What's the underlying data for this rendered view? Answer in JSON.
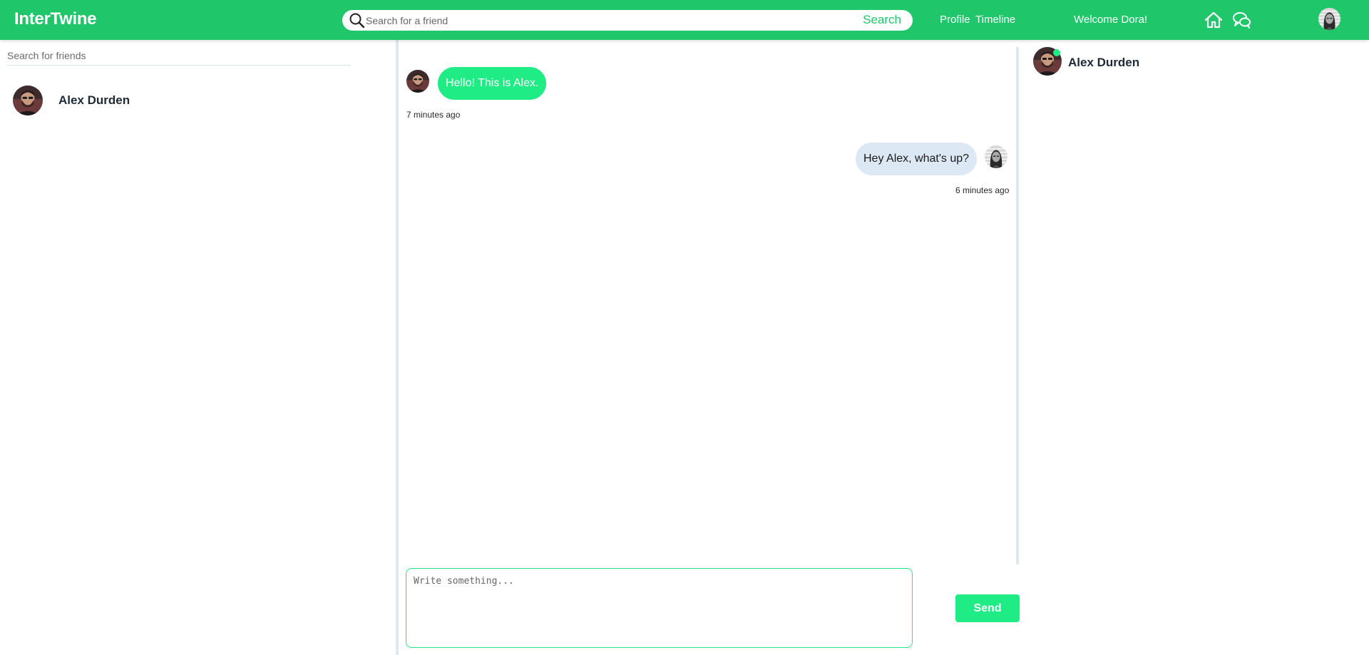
{
  "app": {
    "logo": "InterTwine"
  },
  "topbar": {
    "search_placeholder": "Search for a friend",
    "search_button": "Search",
    "links": [
      "Profile",
      "Timeline"
    ],
    "welcome": "Welcome Dora!",
    "icons": [
      "home-icon",
      "chat-icon"
    ],
    "accent_color": "#1fc66a"
  },
  "left": {
    "search_placeholder": "Search for friends",
    "friends": [
      {
        "name": "Alex Durden"
      }
    ]
  },
  "chat": {
    "messages": [
      {
        "from": "friend",
        "text": "Hello! This is Alex.",
        "time": "7 minutes ago"
      },
      {
        "from": "me",
        "text": "Hey Alex, what's up?",
        "time": "6 minutes ago"
      }
    ],
    "composer_placeholder": "Write something...",
    "send_label": "Send",
    "bubble_in_color": "#1fec85",
    "bubble_out_color": "#dde8f5"
  },
  "online": {
    "friends": [
      {
        "name": "Alex Durden",
        "status": "online"
      }
    ]
  }
}
